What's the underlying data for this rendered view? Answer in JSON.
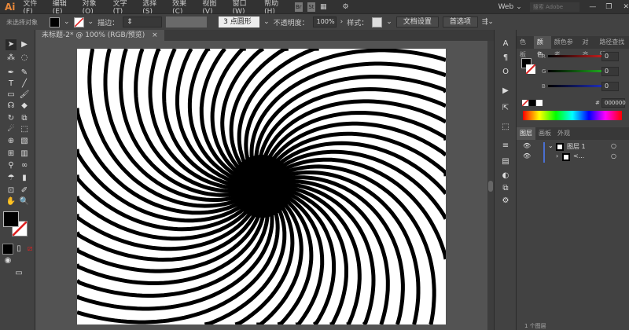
{
  "app": {
    "logo": "Ai",
    "workspace": "Web",
    "search_placeholder": "搜索 Adobe Stock"
  },
  "menu": [
    "文件(F)",
    "编辑(E)",
    "对象(O)",
    "文字(T)",
    "选择(S)",
    "效果(C)",
    "视图(V)",
    "窗口(W)",
    "帮助(H)"
  ],
  "bridge_buttons": [
    "Br",
    "St"
  ],
  "control": {
    "selection": "未选择对象",
    "stroke_label": "描边：",
    "brush": "3 点圆形",
    "opacity_label": "不透明度：",
    "opacity": "100%",
    "style_label": "样式：",
    "doc_setup": "文档设置",
    "prefs": "首选项"
  },
  "document": {
    "tab": "未标题-2* @ 100% (RGB/预览)",
    "close": "×"
  },
  "color_panel": {
    "tabs": [
      "色板",
      "颜色",
      "颜色参考",
      "对齐",
      "路径查找器"
    ],
    "active_tab": 1,
    "channels": [
      {
        "label": "R",
        "value": "0",
        "color": "#c82020"
      },
      {
        "label": "G",
        "value": "0",
        "color": "#20b020"
      },
      {
        "label": "B",
        "value": "0",
        "color": "#2030c0"
      }
    ],
    "hex_label": "#",
    "hex": "000000"
  },
  "layers_panel": {
    "tabs": [
      "图层",
      "画板",
      "外观"
    ],
    "active_tab": 0,
    "layers": [
      {
        "name": "图层 1",
        "expanded": true
      },
      {
        "name": "<...",
        "expanded": false
      }
    ],
    "footer": "1 个图层"
  },
  "artwork": {
    "spokes": 48,
    "twist": 0.006,
    "fill": "#000000"
  }
}
